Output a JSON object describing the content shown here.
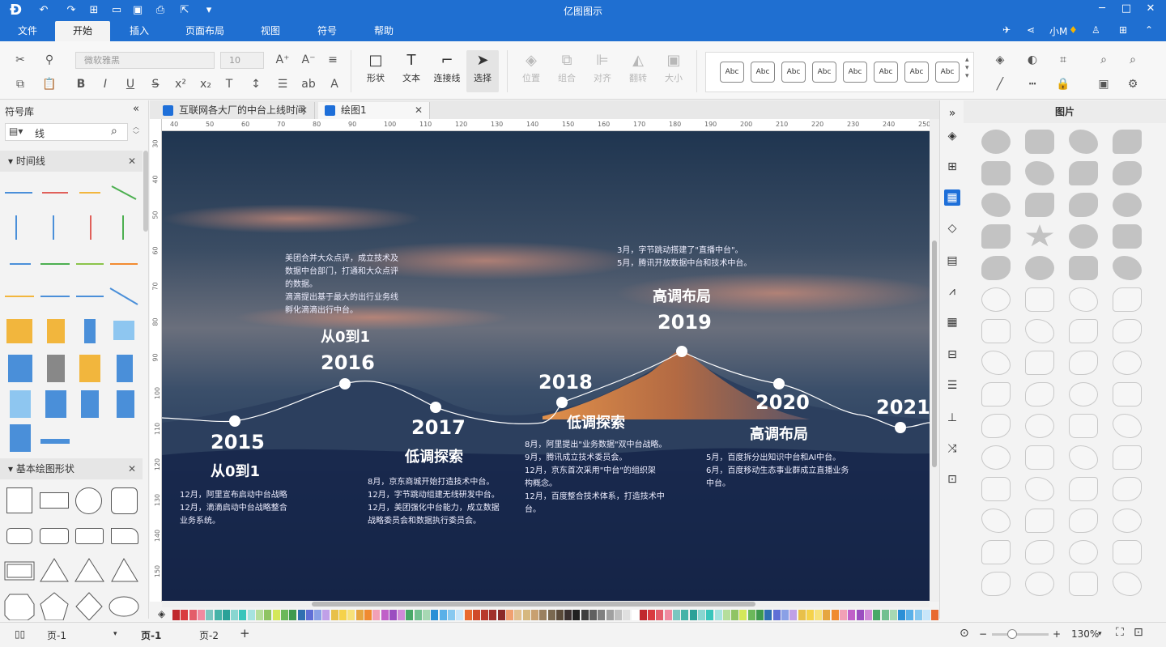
{
  "app": {
    "title": "亿图图示"
  },
  "menu": {
    "items": [
      "文件",
      "开始",
      "插入",
      "页面布局",
      "视图",
      "符号",
      "帮助"
    ],
    "active": "开始",
    "user": "小M"
  },
  "ribbon": {
    "font_name": "微软雅黑",
    "font_size": "10",
    "big_buttons": [
      {
        "label": "形状",
        "icon": "□"
      },
      {
        "label": "文本",
        "icon": "T"
      },
      {
        "label": "连接线",
        "icon": "⌐"
      },
      {
        "label": "选择",
        "icon": "➤"
      },
      {
        "label": "位置",
        "icon": "◈"
      },
      {
        "label": "组合",
        "icon": "⧉"
      },
      {
        "label": "对齐",
        "icon": "⊫"
      },
      {
        "label": "翻转",
        "icon": "◭"
      },
      {
        "label": "大小",
        "icon": "▣"
      }
    ],
    "style_label": "Abc"
  },
  "left_panel": {
    "title": "符号库",
    "search_value": "线",
    "section1": "时间线",
    "section2": "基本绘图形状"
  },
  "tabs": [
    {
      "label": "互联网各大厂的中台上线时间轴"
    },
    {
      "label": "绘图1"
    }
  ],
  "ruler": {
    "h": [
      "40",
      "50",
      "60",
      "70",
      "80",
      "90",
      "100",
      "110",
      "120",
      "130",
      "140",
      "150",
      "160",
      "170",
      "180",
      "190",
      "200",
      "210",
      "220",
      "230",
      "240",
      "250"
    ],
    "v": [
      "30",
      "40",
      "50",
      "60",
      "70",
      "80",
      "90",
      "100",
      "110",
      "120",
      "130",
      "140",
      "150"
    ]
  },
  "timeline": {
    "events": [
      {
        "year": "2015",
        "phase": "从0到1",
        "text": [
          "12月，阿里宣布启动中台战略",
          "12月，滴滴启动中台战略整合",
          "业务系统。"
        ]
      },
      {
        "year": "2016",
        "phase": "从0到1",
        "text": [
          "美团合并大众点评，成立技术及",
          "数据中台部门，打通和大众点评",
          "的数据。",
          "滴滴提出基于最大的出行业务线",
          "孵化滴滴出行中台。"
        ]
      },
      {
        "year": "2017",
        "phase": "低调探索",
        "text": [
          "8月，京东商城开始打造技术中台。",
          "12月，字节跳动组建无线研发中台。",
          "12月，美团强化中台能力，成立数据",
          "战略委员会和数据执行委员会。"
        ]
      },
      {
        "year": "2018",
        "phase": "低调探索",
        "text": [
          "8月，阿里提出\"业务数据\"双中台战略。",
          "9月，腾讯成立技术委员会。",
          "12月，京东首次采用\"中台\"的组织架",
          "构概念。",
          "12月，百度整合技术体系，打造技术中",
          "台。"
        ]
      },
      {
        "year": "2019",
        "phase": "高调布局",
        "text": [
          "3月，字节跳动搭建了\"直播中台\"。",
          "5月，腾讯开放数据中台和技术中台。"
        ]
      },
      {
        "year": "2020",
        "phase": "高调布局",
        "text": [
          "5月，百度拆分出知识中台和AI中台。",
          "6月，百度移动生态事业群成立直播业务",
          "中台。"
        ]
      },
      {
        "year": "2021",
        "phase": "",
        "text": []
      }
    ]
  },
  "right_panel": {
    "title": "图片"
  },
  "status": {
    "page_select": "页-1",
    "pages": [
      "页-1",
      "页-2"
    ],
    "zoom": "130%"
  },
  "colors": {
    "accent": "#1f6fd1",
    "titlebar": "#1f6fd1"
  }
}
